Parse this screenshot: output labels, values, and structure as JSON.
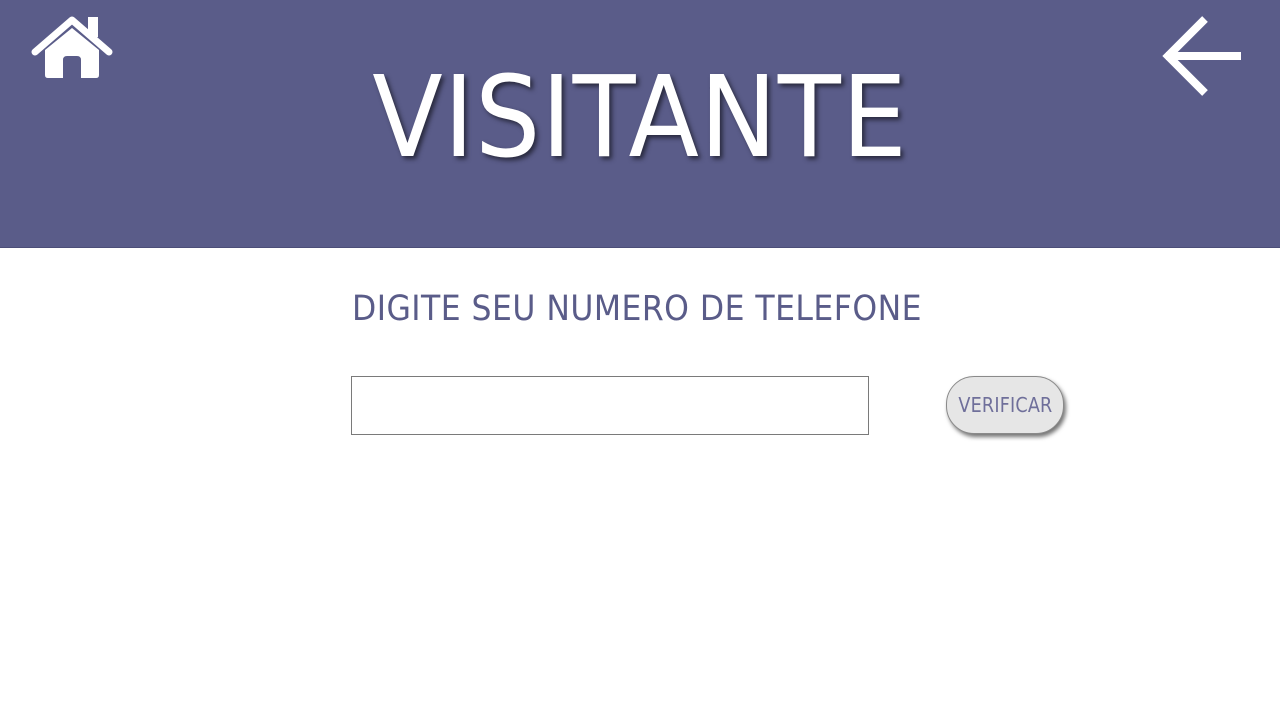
{
  "header": {
    "title": "VISITANTE",
    "background_color": "#5a5c89",
    "home_icon": "home-icon",
    "back_icon": "arrow-left-icon"
  },
  "main": {
    "prompt": "DIGITE SEU NUMERO DE TELEFONE",
    "phone_input": {
      "value": "",
      "placeholder": ""
    },
    "verify_button_label": "VERIFICAR"
  },
  "colors": {
    "accent": "#5a5c89",
    "button_bg": "#e6e6e6",
    "button_text": "#6f6f9a"
  }
}
